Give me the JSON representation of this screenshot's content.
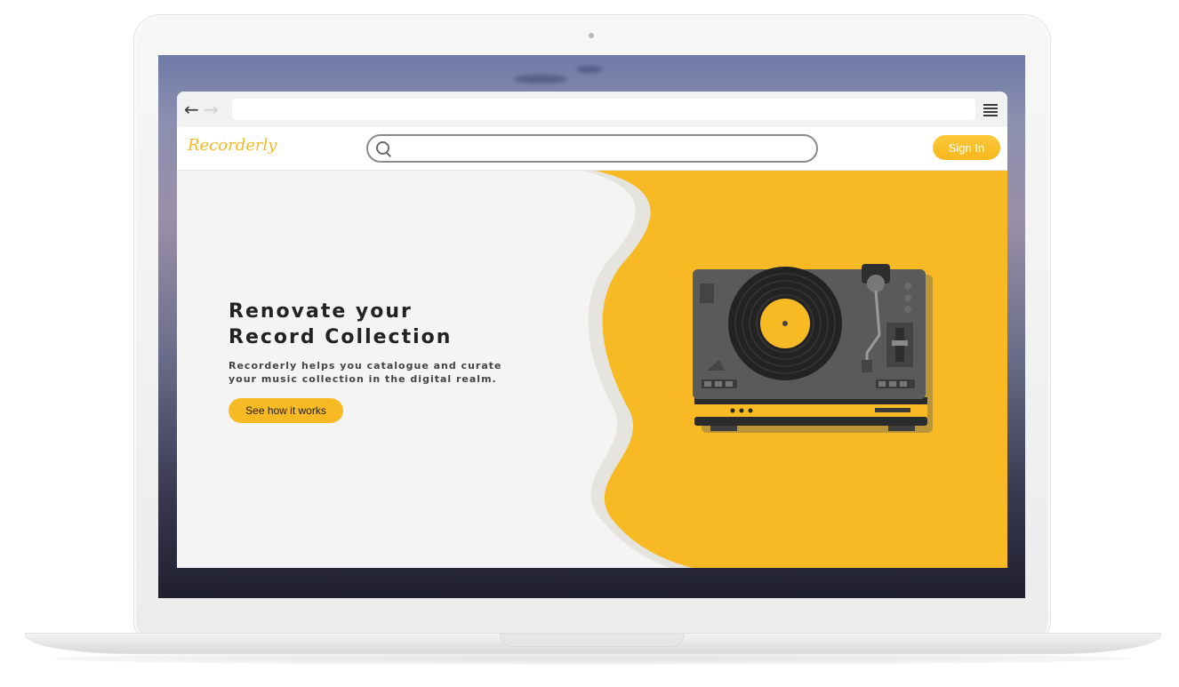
{
  "site": {
    "logo": "Recorderly",
    "search_placeholder": "",
    "signin_label": "Sign In"
  },
  "hero": {
    "headline_line1": "Renovate your",
    "headline_line2": "Record Collection",
    "tagline_line1": "Recorderly helps you catalogue and curate",
    "tagline_line2": "your music collection in the digital realm.",
    "cta_label": "See how it works"
  },
  "colors": {
    "accent": "#f7b924",
    "page_bg": "#f4f4f4",
    "text": "#222222"
  },
  "icons": [
    "back-arrow-icon",
    "forward-arrow-icon",
    "hamburger-menu-icon",
    "search-icon",
    "turntable-illustration"
  ]
}
